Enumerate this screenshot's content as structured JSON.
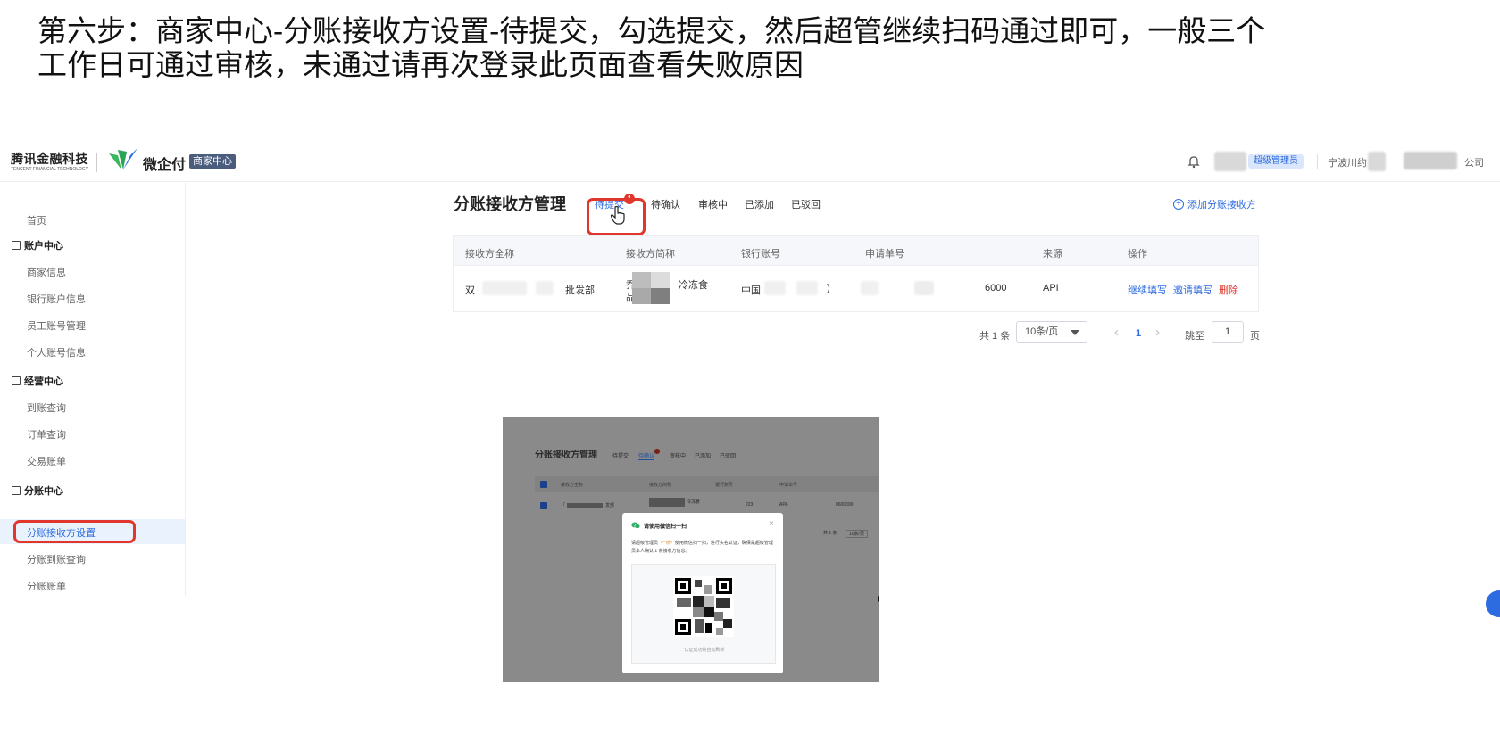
{
  "instruction": "第六步：商家中心-分账接收方设置-待提交，勾选提交，然后超管继续扫码通过即可，一般三个工作日可通过审核，未通过请再次登录此页面查看失败原因",
  "header": {
    "brand_cn": "腾讯金融科技",
    "brand_en": "TENCENT FINANCIAL TECHNOLOGY",
    "product": "微企付",
    "center_tag": "商家中心",
    "role_badge": "超级管理员",
    "company_prefix": "宁波川约",
    "company_suffix": "公司"
  },
  "sidebar": {
    "home": "首页",
    "groups": [
      {
        "label": "账户中心",
        "items": [
          "商家信息",
          "银行账户信息",
          "员工账号管理",
          "个人账号信息"
        ]
      },
      {
        "label": "经营中心",
        "items": [
          "到账查询",
          "订单查询",
          "交易账单"
        ]
      },
      {
        "label": "分账中心",
        "items": [
          "分账接收方设置",
          "分账到账查询",
          "分账账单"
        ]
      }
    ],
    "active_item": "分账接收方设置"
  },
  "main": {
    "title": "分账接收方管理",
    "tabs": [
      "待提交",
      "待确认",
      "审核中",
      "已添加",
      "已驳回"
    ],
    "active_tab": "待提交",
    "active_tab_badge": "1",
    "add_button": "添加分账接收方",
    "table": {
      "columns": [
        "接收方全称",
        "接收方简称",
        "银行账号",
        "申请单号",
        "来源",
        "操作"
      ],
      "rows": [
        {
          "full_name_start": "双",
          "full_name_end": "批发部",
          "short_name_start": "乔",
          "short_name_end": "冷冻食",
          "short_name_line2": "品",
          "bank_account_start": "中国",
          "bank_account_end": ")",
          "apply_no_end": "6000",
          "source": "API",
          "ops": [
            "继续填写",
            "邀请填写",
            "删除"
          ]
        }
      ]
    },
    "pagination": {
      "total": "共 1 条",
      "page_size": "10条/页",
      "prev": "‹",
      "current_page": "1",
      "next": "›",
      "jump_label": "跳至",
      "jump_value": "1",
      "page_unit": "页"
    }
  },
  "embedded": {
    "title": "分账接收方管理",
    "tabs": [
      "待提交",
      "待确认",
      "审核中",
      "已添加",
      "已驳回"
    ],
    "active_tab": "待确认",
    "columns": [
      "接收方全称",
      "接收方简称",
      "银行账号",
      "申请单号"
    ],
    "row": {
      "full_name_start": "「",
      "full_name_end": "发部",
      "short_name_end": "冷冻食",
      "bank_end": "223",
      "source": "APA",
      "apply_end": "0600000"
    },
    "pager": {
      "total": "共 1 条",
      "page_size": "10条/页"
    },
    "modal": {
      "title": "请使用微信扫一扫",
      "close": "×",
      "desc_pre": "请超级管理员",
      "desc_role": "（**桥）",
      "desc_post": "使用微信扫一扫，进行实名认证，确保是超级管理员本人确认 1 条接收方信息。",
      "hint": "认证成功将自动刷新"
    }
  },
  "colors": {
    "accent": "#2d6be0",
    "highlight": "#e0362c",
    "logo_green": "#3cb55f",
    "logo_blue": "#2d6be0"
  }
}
